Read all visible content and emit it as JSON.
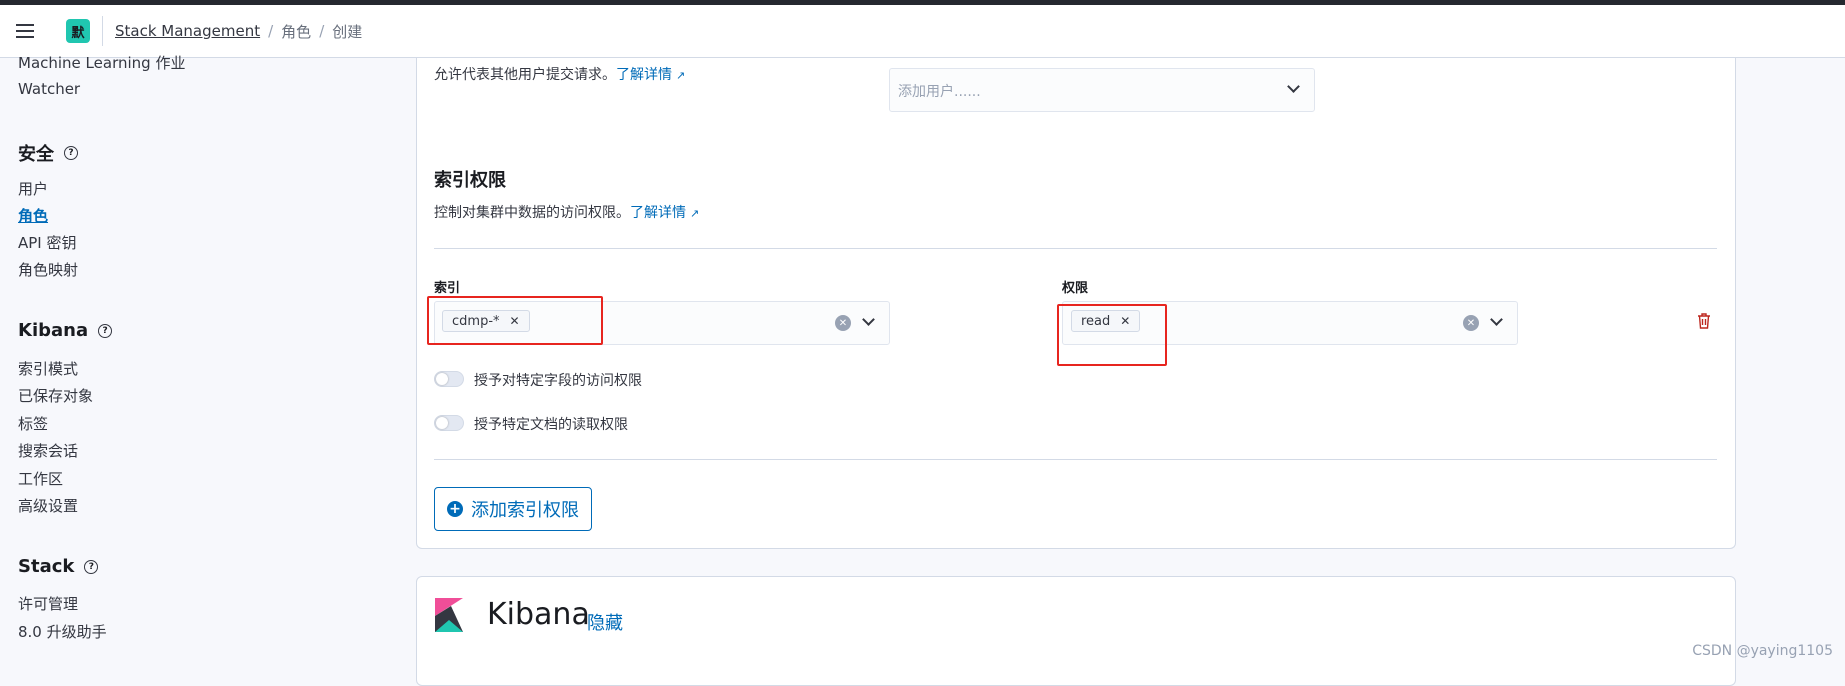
{
  "header": {
    "space_initial": "默",
    "breadcrumbs": [
      "Stack Management",
      "角色",
      "创建"
    ]
  },
  "sidebar": {
    "partial_item": "Machine Learning 作业",
    "watcher": "Watcher",
    "security_title": "安全",
    "security_items": [
      "用户",
      "角色",
      "API 密钥",
      "角色映射"
    ],
    "kibana_title": "Kibana",
    "kibana_items": [
      "索引模式",
      "已保存对象",
      "标签",
      "搜索会话",
      "工作区",
      "高级设置"
    ],
    "stack_title": "Stack",
    "stack_items": [
      "许可管理",
      "8.0 升级助手"
    ]
  },
  "run_as": {
    "desc": "允许代表其他用户提交请求。",
    "learn_more": "了解详情",
    "placeholder": "添加用户......"
  },
  "index_priv": {
    "title": "索引权限",
    "desc": "控制对集群中数据的访问权限。",
    "learn_more": "了解详情",
    "indices_label": "索引",
    "indices_value": "cdmp-*",
    "privileges_label": "权限",
    "privileges_value": "read",
    "field_toggle": "授予对特定字段的访问权限",
    "doc_toggle": "授予特定文档的读取权限",
    "add_button": "添加索引权限"
  },
  "kibana_section": {
    "title": "Kibana",
    "hide": "隐藏"
  },
  "watermark": "CSDN @yaying1105",
  "colors": {
    "accent": "#006bb8",
    "highlight": "#e7251f",
    "danger": "#bd271e",
    "space_badge": "#20c6b0"
  }
}
